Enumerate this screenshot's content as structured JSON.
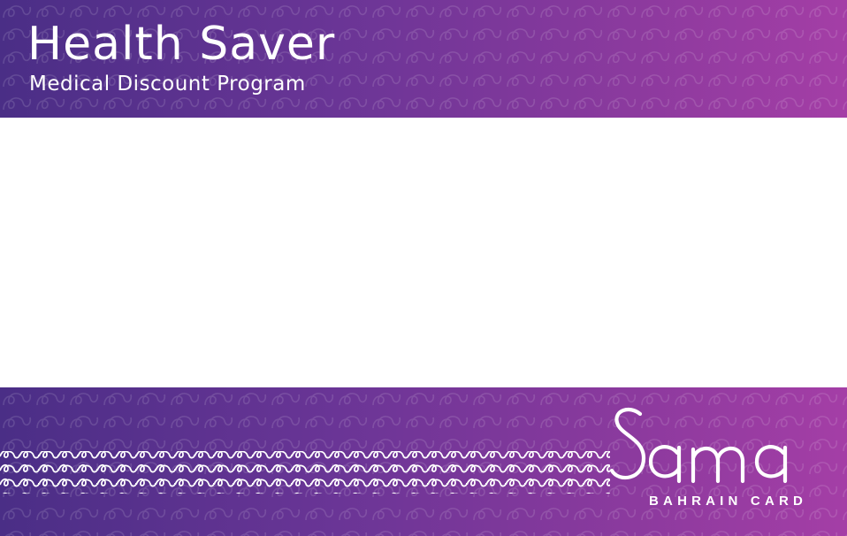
{
  "card": {
    "title": "Health Saver",
    "subtitle": "Medical Discount Program",
    "brand": {
      "logo_text": "Sama",
      "tagline": "BAHRAIN CARD"
    },
    "colors": {
      "band_start": "#4a2e86",
      "band_end": "#a43ea6",
      "text": "#ffffff",
      "body": "#ffffff"
    }
  }
}
